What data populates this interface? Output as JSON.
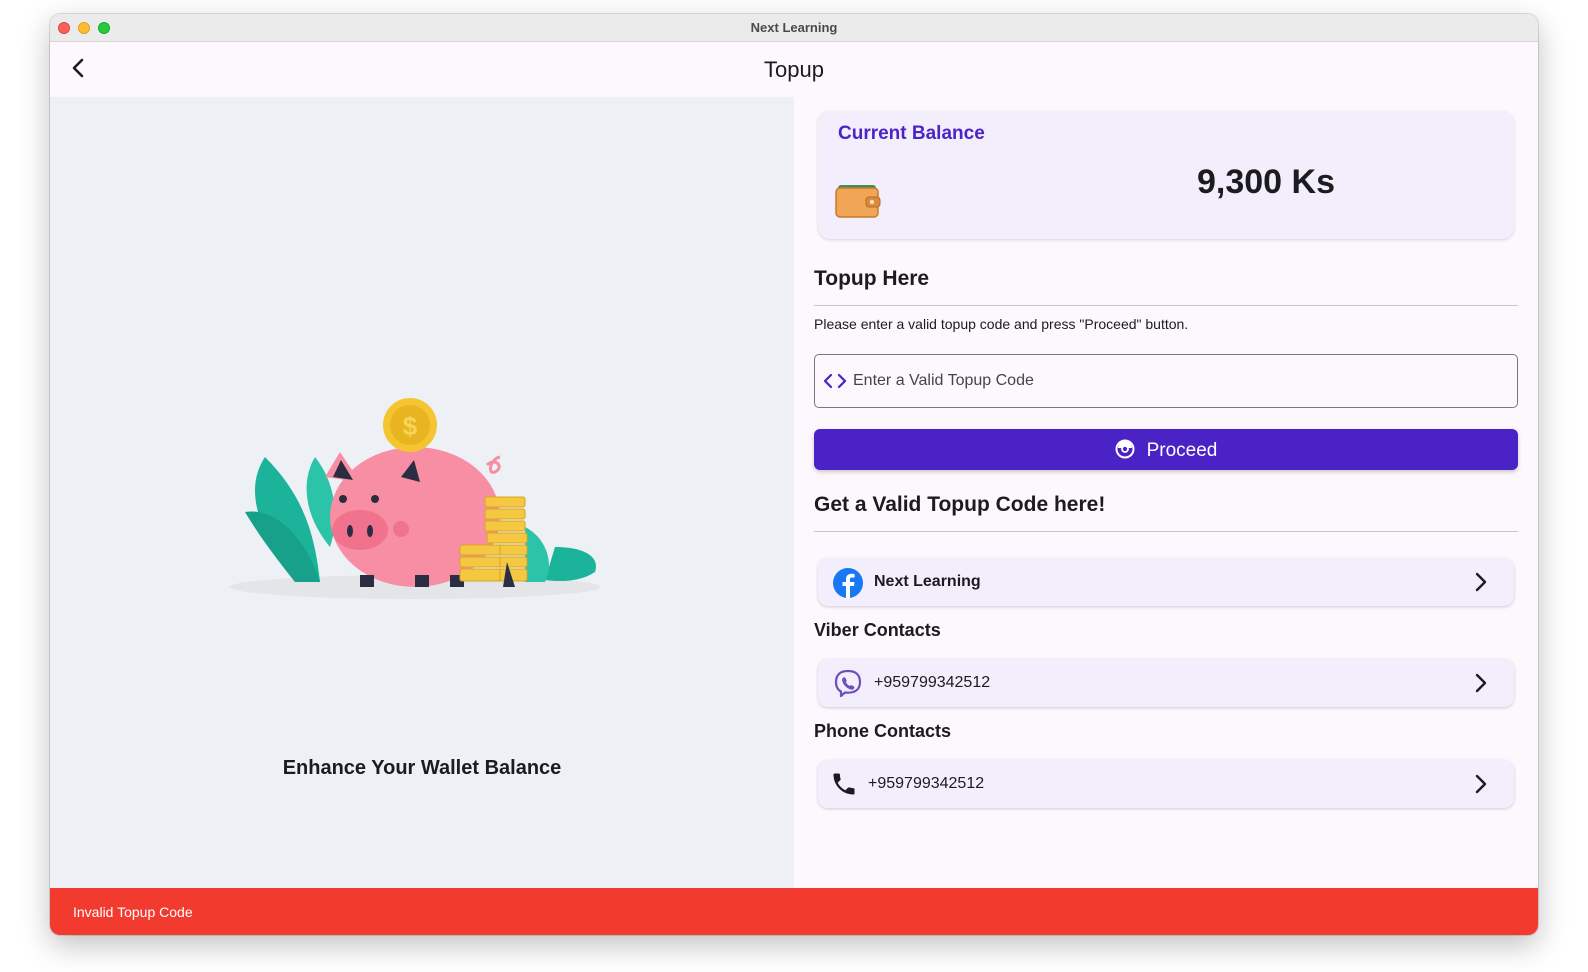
{
  "window": {
    "title": "Next Learning"
  },
  "appbar": {
    "title": "Topup"
  },
  "left": {
    "caption": "Enhance Your Wallet Balance"
  },
  "balance": {
    "label": "Current Balance",
    "amount": "9,300 Ks"
  },
  "topup": {
    "title": "Topup Here",
    "hint": "Please enter a valid topup code and press \"Proceed\" button.",
    "placeholder": "Enter a Valid Topup Code",
    "value": "",
    "proceed_label": "Proceed"
  },
  "get_code": {
    "title": "Get a Valid Topup Code here!",
    "facebook": {
      "label": "Next Learning",
      "icon": "facebook-icon"
    },
    "viber_title": "Viber Contacts",
    "viber": {
      "label": "+959799342512",
      "icon": "viber-icon"
    },
    "phone_title": "Phone Contacts",
    "phone": {
      "label": "+959799342512",
      "icon": "phone-icon"
    }
  },
  "snackbar": {
    "message": "Invalid Topup Code"
  },
  "colors": {
    "accent": "#4a22c5",
    "error": "#f33a2f",
    "balance_label": "#4d22c7",
    "left_pane": "#edf1f5"
  }
}
